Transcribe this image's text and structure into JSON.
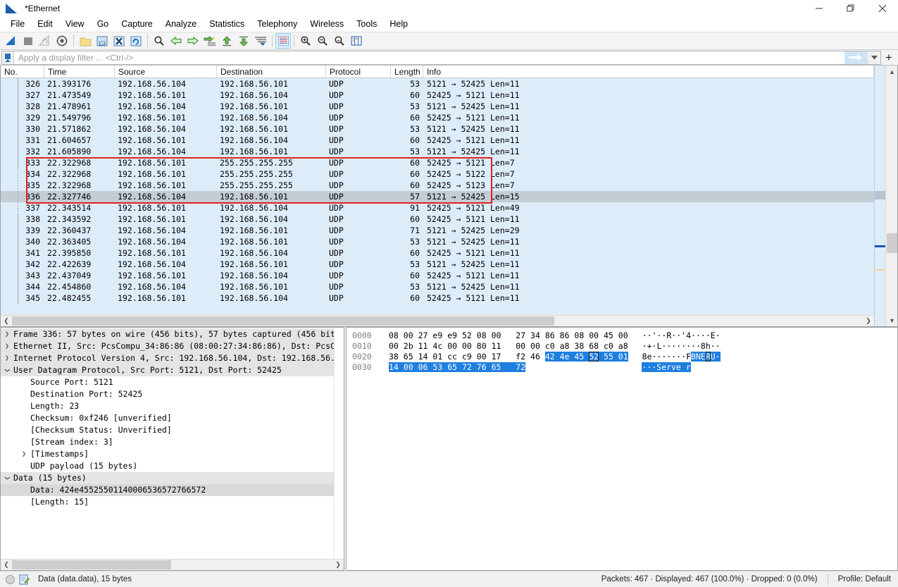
{
  "window": {
    "title": "*Ethernet",
    "icon": "wireshark-fin-icon",
    "controls": [
      {
        "name": "minimize-button",
        "glyph": "minimize-icon"
      },
      {
        "name": "maximize-button",
        "glyph": "restore-icon"
      },
      {
        "name": "close-button",
        "glyph": "close-icon"
      }
    ]
  },
  "menubar": {
    "items": [
      "File",
      "Edit",
      "View",
      "Go",
      "Capture",
      "Analyze",
      "Statistics",
      "Telephony",
      "Wireless",
      "Tools",
      "Help"
    ]
  },
  "toolbar": {
    "buttons": [
      {
        "name": "start-capture-button",
        "icon": "shark-fin-icon"
      },
      {
        "name": "stop-capture-button",
        "icon": "stop-square-icon"
      },
      {
        "name": "restart-capture-button",
        "icon": "restart-fin-icon"
      },
      {
        "name": "capture-options-button",
        "icon": "gear-icon"
      },
      {
        "name": "open-file-button",
        "icon": "folder-icon"
      },
      {
        "name": "save-file-button",
        "icon": "save-disk-icon"
      },
      {
        "name": "close-file-button",
        "icon": "close-x-icon"
      },
      {
        "name": "reload-file-button",
        "icon": "reload-icon"
      },
      {
        "name": "find-packet-button",
        "icon": "magnifier-icon"
      },
      {
        "name": "go-back-button",
        "icon": "arrow-left-icon"
      },
      {
        "name": "go-forward-button",
        "icon": "arrow-right-icon"
      },
      {
        "name": "go-to-packet-button",
        "icon": "goto-packet-icon"
      },
      {
        "name": "go-to-first-button",
        "icon": "arrow-up-icon"
      },
      {
        "name": "go-to-last-button",
        "icon": "arrow-down-icon"
      },
      {
        "name": "autoscroll-button",
        "icon": "autoscroll-icon"
      },
      {
        "name": "colorize-button",
        "icon": "colorize-icon"
      },
      {
        "name": "zoom-in-button",
        "icon": "zoom-in-icon"
      },
      {
        "name": "zoom-out-button",
        "icon": "zoom-out-icon"
      },
      {
        "name": "zoom-reset-button",
        "icon": "zoom-reset-icon"
      },
      {
        "name": "resize-columns-button",
        "icon": "resize-columns-icon"
      }
    ]
  },
  "filter": {
    "placeholder": "Apply a display filter ... <Ctrl-/>",
    "value": "",
    "bookmark_icon": "bookmark-icon",
    "apply_icon": "arrow-right-icon",
    "dropdown_icon": "chevron-down-icon",
    "add_icon": "plus-icon"
  },
  "packet_list": {
    "columns": [
      "No.",
      "Time",
      "Source",
      "Destination",
      "Protocol",
      "Length",
      "Info"
    ],
    "rows": [
      {
        "no": "326",
        "time": "21.393176",
        "src": "192.168.56.104",
        "dst": "192.168.56.101",
        "proto": "UDP",
        "len": "53",
        "info": "5121 → 52425 Len=11"
      },
      {
        "no": "327",
        "time": "21.473549",
        "src": "192.168.56.101",
        "dst": "192.168.56.104",
        "proto": "UDP",
        "len": "60",
        "info": "52425 → 5121 Len=11"
      },
      {
        "no": "328",
        "time": "21.478961",
        "src": "192.168.56.104",
        "dst": "192.168.56.101",
        "proto": "UDP",
        "len": "53",
        "info": "5121 → 52425 Len=11"
      },
      {
        "no": "329",
        "time": "21.549796",
        "src": "192.168.56.101",
        "dst": "192.168.56.104",
        "proto": "UDP",
        "len": "60",
        "info": "52425 → 5121 Len=11"
      },
      {
        "no": "330",
        "time": "21.571862",
        "src": "192.168.56.104",
        "dst": "192.168.56.101",
        "proto": "UDP",
        "len": "53",
        "info": "5121 → 52425 Len=11"
      },
      {
        "no": "331",
        "time": "21.604657",
        "src": "192.168.56.101",
        "dst": "192.168.56.104",
        "proto": "UDP",
        "len": "60",
        "info": "52425 → 5121 Len=11"
      },
      {
        "no": "332",
        "time": "21.605890",
        "src": "192.168.56.104",
        "dst": "192.168.56.101",
        "proto": "UDP",
        "len": "53",
        "info": "5121 → 52425 Len=11"
      },
      {
        "no": "333",
        "time": "22.322968",
        "src": "192.168.56.101",
        "dst": "255.255.255.255",
        "proto": "UDP",
        "len": "60",
        "info": "52425 → 5121 Len=7"
      },
      {
        "no": "334",
        "time": "22.322968",
        "src": "192.168.56.101",
        "dst": "255.255.255.255",
        "proto": "UDP",
        "len": "60",
        "info": "52425 → 5122 Len=7"
      },
      {
        "no": "335",
        "time": "22.322968",
        "src": "192.168.56.101",
        "dst": "255.255.255.255",
        "proto": "UDP",
        "len": "60",
        "info": "52425 → 5123 Len=7"
      },
      {
        "no": "336",
        "time": "22.327746",
        "src": "192.168.56.104",
        "dst": "192.168.56.101",
        "proto": "UDP",
        "len": "57",
        "info": "5121 → 52425 Len=15",
        "selected": true
      },
      {
        "no": "337",
        "time": "22.343514",
        "src": "192.168.56.101",
        "dst": "192.168.56.104",
        "proto": "UDP",
        "len": "91",
        "info": "52425 → 5121 Len=49"
      },
      {
        "no": "338",
        "time": "22.343592",
        "src": "192.168.56.101",
        "dst": "192.168.56.104",
        "proto": "UDP",
        "len": "60",
        "info": "52425 → 5121 Len=11"
      },
      {
        "no": "339",
        "time": "22.360437",
        "src": "192.168.56.104",
        "dst": "192.168.56.101",
        "proto": "UDP",
        "len": "71",
        "info": "5121 → 52425 Len=29"
      },
      {
        "no": "340",
        "time": "22.363405",
        "src": "192.168.56.104",
        "dst": "192.168.56.101",
        "proto": "UDP",
        "len": "53",
        "info": "5121 → 52425 Len=11"
      },
      {
        "no": "341",
        "time": "22.395850",
        "src": "192.168.56.101",
        "dst": "192.168.56.104",
        "proto": "UDP",
        "len": "60",
        "info": "52425 → 5121 Len=11"
      },
      {
        "no": "342",
        "time": "22.422639",
        "src": "192.168.56.104",
        "dst": "192.168.56.101",
        "proto": "UDP",
        "len": "53",
        "info": "5121 → 52425 Len=11"
      },
      {
        "no": "343",
        "time": "22.437049",
        "src": "192.168.56.101",
        "dst": "192.168.56.104",
        "proto": "UDP",
        "len": "60",
        "info": "52425 → 5121 Len=11"
      },
      {
        "no": "344",
        "time": "22.454860",
        "src": "192.168.56.104",
        "dst": "192.168.56.101",
        "proto": "UDP",
        "len": "53",
        "info": "5121 → 52425 Len=11"
      },
      {
        "no": "345",
        "time": "22.482455",
        "src": "192.168.56.101",
        "dst": "192.168.56.104",
        "proto": "UDP",
        "len": "60",
        "info": "52425 → 5121 Len=11"
      }
    ],
    "annotation": {
      "name": "red-highlight-box",
      "color": "#e02020"
    }
  },
  "detail_pane": {
    "rows": [
      {
        "indent": 0,
        "twisty": "right",
        "text": "Frame 336: 57 bytes on wire (456 bits), 57 bytes captured (456 bit",
        "highlight": "light"
      },
      {
        "indent": 0,
        "twisty": "right",
        "text": "Ethernet II, Src: PcsCompu_34:86:86 (08:00:27:34:86:86), Dst: PcsC",
        "highlight": "light"
      },
      {
        "indent": 0,
        "twisty": "right",
        "text": "Internet Protocol Version 4, Src: 192.168.56.104, Dst: 192.168.56.",
        "highlight": "light"
      },
      {
        "indent": 0,
        "twisty": "down",
        "text": "User Datagram Protocol, Src Port: 5121, Dst Port: 52425",
        "highlight": "light"
      },
      {
        "indent": 1,
        "twisty": "none",
        "text": "Source Port: 5121",
        "highlight": "none"
      },
      {
        "indent": 1,
        "twisty": "none",
        "text": "Destination Port: 52425",
        "highlight": "none"
      },
      {
        "indent": 1,
        "twisty": "none",
        "text": "Length: 23",
        "highlight": "none"
      },
      {
        "indent": 1,
        "twisty": "none",
        "text": "Checksum: 0xf246 [unverified]",
        "highlight": "none"
      },
      {
        "indent": 1,
        "twisty": "none",
        "text": "[Checksum Status: Unverified]",
        "highlight": "none"
      },
      {
        "indent": 1,
        "twisty": "none",
        "text": "[Stream index: 3]",
        "highlight": "none"
      },
      {
        "indent": 1,
        "twisty": "right",
        "text": "[Timestamps]",
        "highlight": "none"
      },
      {
        "indent": 1,
        "twisty": "none",
        "text": "UDP payload (15 bytes)",
        "highlight": "none"
      },
      {
        "indent": 0,
        "twisty": "down",
        "text": "Data (15 bytes)",
        "highlight": "light"
      },
      {
        "indent": 1,
        "twisty": "none",
        "text": "Data: 424e45525501140006536572766572",
        "highlight": "medium"
      },
      {
        "indent": 1,
        "twisty": "none",
        "text": "[Length: 15]",
        "highlight": "none"
      }
    ]
  },
  "bytes_pane": {
    "rows": [
      {
        "offset": "0000",
        "bytes": [
          {
            "v": "08"
          },
          {
            "v": "00"
          },
          {
            "v": "27"
          },
          {
            "v": "e9"
          },
          {
            "v": "e9"
          },
          {
            "v": "52"
          },
          {
            "v": "08"
          },
          {
            "v": "00"
          },
          {
            "v": "27"
          },
          {
            "v": "34"
          },
          {
            "v": "86"
          },
          {
            "v": "86"
          },
          {
            "v": "08"
          },
          {
            "v": "00"
          },
          {
            "v": "45"
          },
          {
            "v": "00"
          }
        ],
        "ascii": [
          {
            "v": "·"
          },
          {
            "v": "·"
          },
          {
            "v": "'"
          },
          {
            "v": "·"
          },
          {
            "v": "·"
          },
          {
            "v": "R"
          },
          {
            "v": "·"
          },
          {
            "v": "·"
          },
          {
            "v": "'"
          },
          {
            "v": "4"
          },
          {
            "v": "·"
          },
          {
            "v": "·"
          },
          {
            "v": "·"
          },
          {
            "v": "·"
          },
          {
            "v": "E"
          },
          {
            "v": "·"
          }
        ]
      },
      {
        "offset": "0010",
        "bytes": [
          {
            "v": "00"
          },
          {
            "v": "2b"
          },
          {
            "v": "11"
          },
          {
            "v": "4c"
          },
          {
            "v": "00"
          },
          {
            "v": "00"
          },
          {
            "v": "80"
          },
          {
            "v": "11"
          },
          {
            "v": "00"
          },
          {
            "v": "00"
          },
          {
            "v": "c0"
          },
          {
            "v": "a8"
          },
          {
            "v": "38"
          },
          {
            "v": "68"
          },
          {
            "v": "c0"
          },
          {
            "v": "a8"
          }
        ],
        "ascii": [
          {
            "v": "·"
          },
          {
            "v": "+"
          },
          {
            "v": "·"
          },
          {
            "v": "L"
          },
          {
            "v": "·"
          },
          {
            "v": "·"
          },
          {
            "v": "·"
          },
          {
            "v": "·"
          },
          {
            "v": "·"
          },
          {
            "v": "·"
          },
          {
            "v": "·"
          },
          {
            "v": "·"
          },
          {
            "v": "8"
          },
          {
            "v": "h"
          },
          {
            "v": "·"
          },
          {
            "v": "·"
          }
        ]
      },
      {
        "offset": "0020",
        "bytes": [
          {
            "v": "38"
          },
          {
            "v": "65"
          },
          {
            "v": "14"
          },
          {
            "v": "01"
          },
          {
            "v": "cc"
          },
          {
            "v": "c9"
          },
          {
            "v": "00"
          },
          {
            "v": "17"
          },
          {
            "v": "f2"
          },
          {
            "v": "46"
          },
          {
            "v": "42",
            "hl": true
          },
          {
            "v": "4e",
            "hl": true
          },
          {
            "v": "45",
            "hl": true
          },
          {
            "v": "52",
            "hl": true,
            "cursor": true
          },
          {
            "v": "55",
            "hl": true
          },
          {
            "v": "01",
            "hl": true
          }
        ],
        "ascii": [
          {
            "v": "8"
          },
          {
            "v": "e"
          },
          {
            "v": "·"
          },
          {
            "v": "·"
          },
          {
            "v": "·"
          },
          {
            "v": "·"
          },
          {
            "v": "·"
          },
          {
            "v": "·"
          },
          {
            "v": "·"
          },
          {
            "v": "F"
          },
          {
            "v": "B",
            "hl": true
          },
          {
            "v": "N",
            "hl": true
          },
          {
            "v": "E",
            "hl": true
          },
          {
            "v": "R",
            "hl": true,
            "cursor": true
          },
          {
            "v": "U",
            "hl": true
          },
          {
            "v": "·",
            "hl": true
          }
        ]
      },
      {
        "offset": "0030",
        "bytes": [
          {
            "v": "14",
            "hl": true
          },
          {
            "v": "00",
            "hl": true
          },
          {
            "v": "06",
            "hl": true
          },
          {
            "v": "53",
            "hl": true
          },
          {
            "v": "65",
            "hl": true
          },
          {
            "v": "72",
            "hl": true
          },
          {
            "v": "76",
            "hl": true
          },
          {
            "v": "65",
            "hl": true
          },
          {
            "v": "72",
            "hl": true
          }
        ],
        "ascii": [
          {
            "v": "·",
            "hl": true
          },
          {
            "v": "·",
            "hl": true
          },
          {
            "v": "·",
            "hl": true
          },
          {
            "v": "S",
            "hl": true
          },
          {
            "v": "e",
            "hl": true
          },
          {
            "v": "r",
            "hl": true
          },
          {
            "v": "v",
            "hl": true
          },
          {
            "v": "e",
            "hl": true
          },
          {
            "v": " ",
            "hl": true
          },
          {
            "v": "r",
            "hl": true
          }
        ]
      }
    ]
  },
  "statusbar": {
    "expert_icon": "expert-info-circle-icon",
    "capture_comment_icon": "capture-comment-icon",
    "field_text": "Data (data.data), 15 bytes",
    "counts": "Packets: 467 · Displayed: 467 (100.0%) · Dropped: 0 (0.0%)",
    "profile": "Profile: Default"
  },
  "colors": {
    "row_background": "#ddecf9",
    "selected_row": "#c4ccd4",
    "hex_highlight": "#1f7fe0",
    "annotation_red": "#e02020",
    "accent_blue": "#2a6fb5"
  }
}
